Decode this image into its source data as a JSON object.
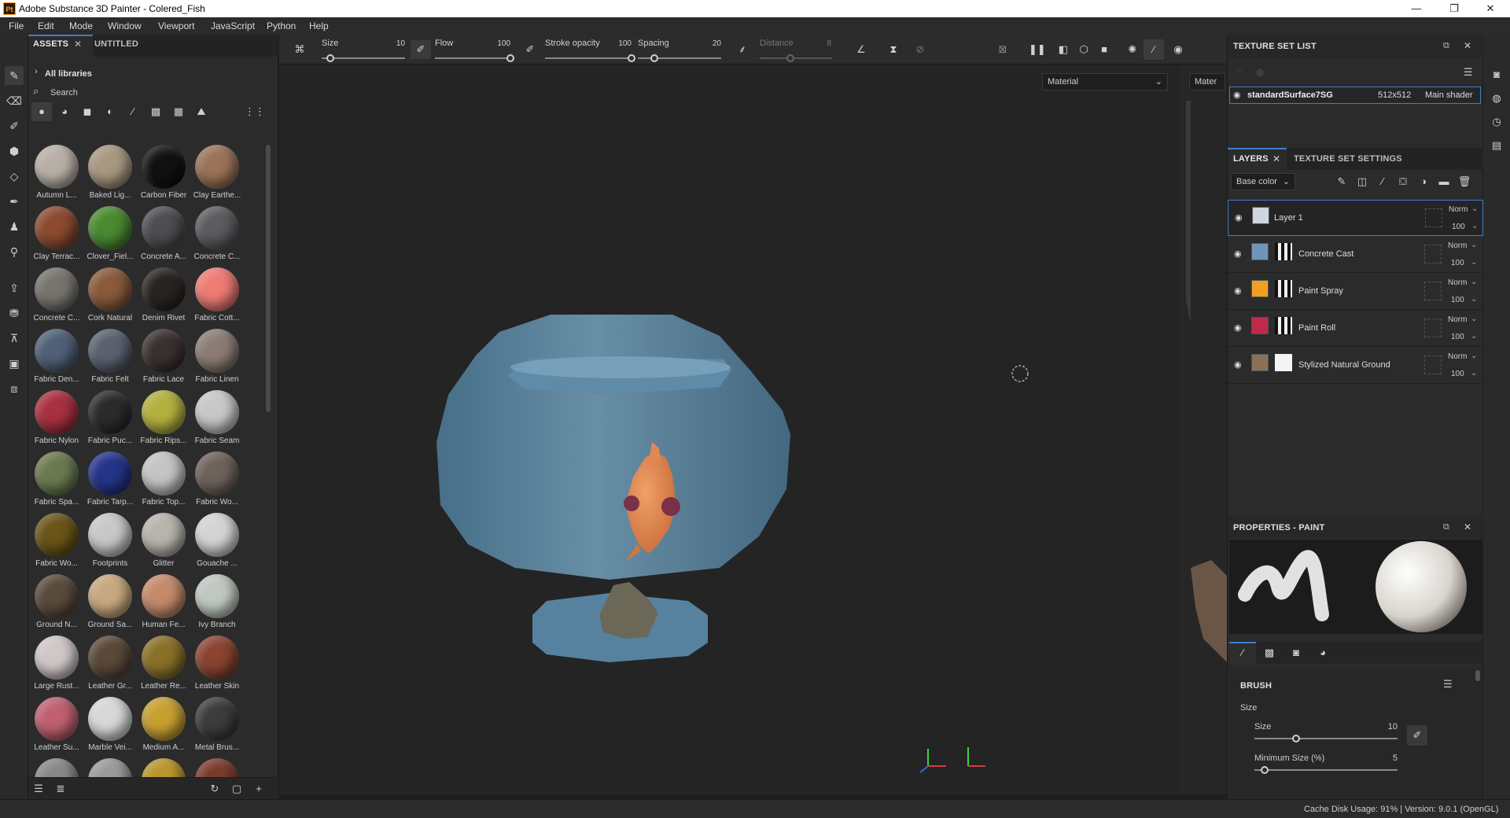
{
  "window": {
    "app_icon": "Pt",
    "title": "Adobe Substance 3D Painter - Colered_Fish",
    "minimize": "—",
    "maximize": "❐",
    "close": "✕"
  },
  "menu": [
    "File",
    "Edit",
    "Mode",
    "Window",
    "Viewport",
    "JavaScript",
    "Python",
    "Help"
  ],
  "assets": {
    "tab_assets": "ASSETS",
    "tab_untitled": "UNTITLED",
    "all_libraries": "All libraries",
    "search": "Search",
    "materials": [
      {
        "label": "Autumn L...",
        "color": "#b8b0a8",
        "accent": "#7a2a1a"
      },
      {
        "label": "Baked Lig...",
        "color": "#a89880"
      },
      {
        "label": "Carbon Fiber",
        "color": "#111111"
      },
      {
        "label": "Clay Earthe...",
        "color": "#9a7358"
      },
      {
        "label": "Clay Terrac...",
        "color": "#8c4a30"
      },
      {
        "label": "Clover_Fiel...",
        "color": "#4a8a30"
      },
      {
        "label": "Concrete A...",
        "color": "#4e4e52"
      },
      {
        "label": "Concrete C...",
        "color": "#5c5c60"
      },
      {
        "label": "Concrete C...",
        "color": "#77746e"
      },
      {
        "label": "Cork Natural",
        "color": "#8a5a3a"
      },
      {
        "label": "Denim Rivet",
        "color": "#2a2420"
      },
      {
        "label": "Fabric Cott...",
        "color": "#f07a74"
      },
      {
        "label": "Fabric Den...",
        "color": "#506078"
      },
      {
        "label": "Fabric Felt",
        "color": "#5a6272"
      },
      {
        "label": "Fabric Lace",
        "color": "#3a3030"
      },
      {
        "label": "Fabric Linen",
        "color": "#8c7c74"
      },
      {
        "label": "Fabric Nylon",
        "color": "#a83040"
      },
      {
        "label": "Fabric Puc...",
        "color": "#2b2b2b"
      },
      {
        "label": "Fabric Rips...",
        "color": "#b4b040"
      },
      {
        "label": "Fabric Seam",
        "color": "#c8c8c8"
      },
      {
        "label": "Fabric Spa...",
        "color": "#6a7a50"
      },
      {
        "label": "Fabric Tarp...",
        "color": "#24348a"
      },
      {
        "label": "Fabric Top...",
        "color": "#c4c4c4"
      },
      {
        "label": "Fabric Wo...",
        "color": "#6e625c"
      },
      {
        "label": "Fabric Wo...",
        "color": "#6a5418"
      },
      {
        "label": "Footprints",
        "color": "#c8c8c8"
      },
      {
        "label": "Glitter",
        "color": "#b8b4ac"
      },
      {
        "label": "Gouache ...",
        "color": "#d4d4d4"
      },
      {
        "label": "Ground N...",
        "color": "#5a4a3c"
      },
      {
        "label": "Ground Sa...",
        "color": "#c8a880"
      },
      {
        "label": "Human Fe...",
        "color": "#c48a6a"
      },
      {
        "label": "Ivy Branch",
        "color": "#c0c8c0"
      },
      {
        "label": "Large Rust...",
        "color": "#d0c8c8"
      },
      {
        "label": "Leather Gr...",
        "color": "#5a4838"
      },
      {
        "label": "Leather Re...",
        "color": "#8a7028"
      },
      {
        "label": "Leather Skin",
        "color": "#8a4430"
      },
      {
        "label": "Leather Su...",
        "color": "#c06070"
      },
      {
        "label": "Marble Vei...",
        "color": "#d8d8d8"
      },
      {
        "label": "Medium A...",
        "color": "#c8a030"
      },
      {
        "label": "Metal Brus...",
        "color": "#3c3c3c"
      },
      {
        "label": "",
        "color": "#888888"
      },
      {
        "label": "",
        "color": "#9a9a9a"
      },
      {
        "label": "",
        "color": "#b8962a"
      },
      {
        "label": "",
        "color": "#7a3a2a"
      }
    ]
  },
  "toolbar": {
    "size_label": "Size",
    "size_value": "10",
    "flow_label": "Flow",
    "flow_value": "100",
    "opacity_label": "Stroke opacity",
    "opacity_value": "100",
    "spacing_label": "Spacing",
    "spacing_value": "20",
    "distance_label": "Distance",
    "distance_value": "8",
    "size_frac": 0.1,
    "flow_frac": 1.0,
    "opacity_frac": 1.0,
    "spacing_frac": 0.2
  },
  "viewport": {
    "dropdown_main": "Material",
    "dropdown_side": "Mater"
  },
  "texture_set_list": {
    "title": "TEXTURE SET LIST",
    "set_name": "standardSurface7SG",
    "resolution": "512x512",
    "shader": "Main shader"
  },
  "layers": {
    "tab_layers": "LAYERS",
    "tab_tss": "TEXTURE SET SETTINGS",
    "channel": "Base color",
    "items": [
      {
        "name": "Layer 1",
        "blend": "Norm",
        "opacity": "100",
        "swatch": "#cfd6e0",
        "selected": true
      },
      {
        "name": "Concrete Cast",
        "blend": "Norm",
        "opacity": "100",
        "swatch": "#6f96b8"
      },
      {
        "name": "Paint Spray",
        "blend": "Norm",
        "opacity": "100",
        "swatch": "#f0a020"
      },
      {
        "name": "Paint Roll",
        "blend": "Norm",
        "opacity": "100",
        "swatch": "#c0284c"
      },
      {
        "name": "Stylized Natural Ground",
        "blend": "Norm",
        "opacity": "100",
        "swatch": "#8a7058"
      }
    ]
  },
  "properties": {
    "title": "PROPERTIES - PAINT",
    "brush": "BRUSH",
    "size_section": "Size",
    "size_label": "Size",
    "size_value": "10",
    "min_size_label": "Minimum Size (%)",
    "min_size_value": "5"
  },
  "status": {
    "text": "Cache Disk Usage:   91% | Version: 9.0.1 (OpenGL)"
  },
  "colors": {
    "accent_blue": "#3b7fcf",
    "bowl": "#5a8aa8",
    "fish": "#e08850"
  }
}
